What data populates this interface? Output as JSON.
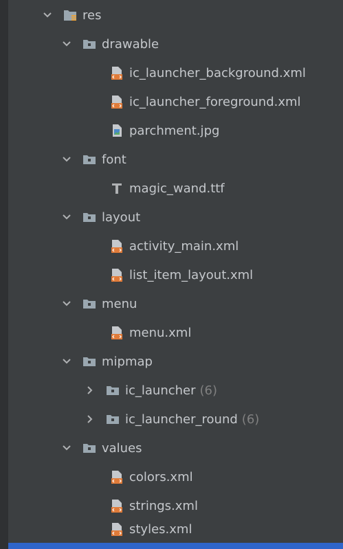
{
  "tree": {
    "root": {
      "label": "res",
      "icon": "resource-folder-icon",
      "expanded": true
    },
    "folders": [
      {
        "label": "drawable",
        "icon": "folder-icon",
        "expanded": true,
        "files": [
          {
            "label": "ic_launcher_background.xml",
            "icon": "xml-file-icon"
          },
          {
            "label": "ic_launcher_foreground.xml",
            "icon": "xml-file-icon"
          },
          {
            "label": "parchment.jpg",
            "icon": "image-file-icon"
          }
        ]
      },
      {
        "label": "font",
        "icon": "folder-icon",
        "expanded": true,
        "files": [
          {
            "label": "magic_wand.ttf",
            "icon": "font-file-icon"
          }
        ]
      },
      {
        "label": "layout",
        "icon": "folder-icon",
        "expanded": true,
        "files": [
          {
            "label": "activity_main.xml",
            "icon": "xml-file-icon"
          },
          {
            "label": "list_item_layout.xml",
            "icon": "xml-file-icon"
          }
        ]
      },
      {
        "label": "menu",
        "icon": "folder-icon",
        "expanded": true,
        "files": [
          {
            "label": "menu.xml",
            "icon": "xml-file-icon"
          }
        ]
      },
      {
        "label": "mipmap",
        "icon": "folder-icon",
        "expanded": true,
        "subfolders": [
          {
            "label": "ic_launcher",
            "count": "(6)",
            "icon": "folder-icon",
            "expanded": false
          },
          {
            "label": "ic_launcher_round",
            "count": "(6)",
            "icon": "folder-icon",
            "expanded": false
          }
        ]
      },
      {
        "label": "values",
        "icon": "folder-icon",
        "expanded": true,
        "files": [
          {
            "label": "colors.xml",
            "icon": "xml-file-icon"
          },
          {
            "label": "strings.xml",
            "icon": "xml-file-icon"
          },
          {
            "label": "styles.xml",
            "icon": "xml-file-icon"
          }
        ]
      }
    ]
  },
  "colors": {
    "background": "#3c3f41",
    "text": "#c5c8cc",
    "count": "#808080",
    "selection_bar": "#2f65ca",
    "xml_icon": "#e07b39"
  }
}
